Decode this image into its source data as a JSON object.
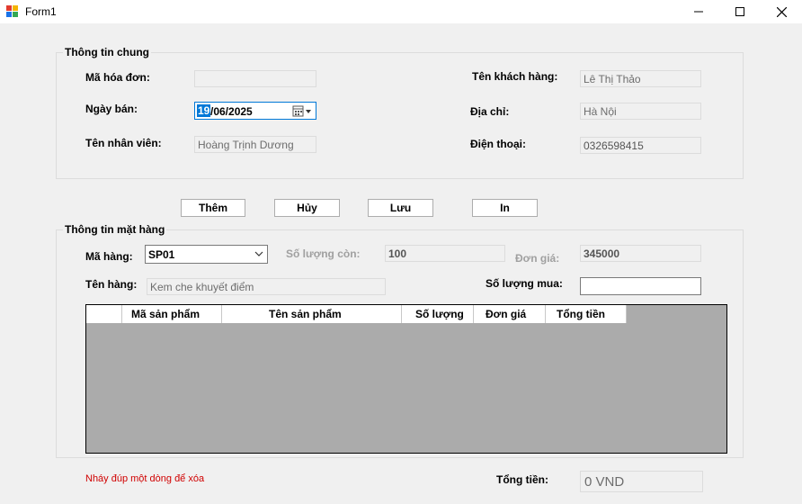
{
  "window": {
    "title": "Form1",
    "icons": {
      "app": "app-form-icon",
      "minimize": "minimize-icon",
      "maximize": "maximize-icon",
      "close": "close-icon"
    }
  },
  "general_info": {
    "title": "Thông tin chung",
    "invoice_id_label": "Mã hóa đơn:",
    "invoice_id_value": "",
    "sale_date_label": "Ngày bán:",
    "sale_date": {
      "day": "19",
      "rest": "/06/2025"
    },
    "employee_label": "Tên nhân viên:",
    "employee_value": "Hoàng Trịnh Dương",
    "customer_label": "Tên khách hàng:",
    "customer_value": "Lê Thị Thảo",
    "address_label": "Địa chỉ:",
    "address_value": "Hà Nội",
    "phone_label": "Điện thoại:",
    "phone_value": "0326598415"
  },
  "buttons": {
    "add": "Thêm",
    "cancel": "Hủy",
    "save": "Lưu",
    "print": "In"
  },
  "item_info": {
    "title": "Thông tin mặt hàng",
    "item_code_label": "Mã hàng:",
    "item_code_value": "SP01",
    "stock_label": "Số lượng còn:",
    "stock_value": "100",
    "unit_price_label": "Đơn giá:",
    "unit_price_value": "345000",
    "item_name_label": "Tên hàng:",
    "item_name_value": "Kem che khuyết điểm",
    "buy_qty_label": "Số lượng mua:",
    "buy_qty_value": ""
  },
  "grid": {
    "columns": [
      "Mã sản phẩm",
      "Tên sản phẩm",
      "Số lượng",
      "Đơn giá",
      "Tổng tiền"
    ],
    "rows": []
  },
  "footer": {
    "hint": "Nháy đúp một dòng để xóa",
    "total_label": "Tổng tiền:",
    "total_value": "0 VND"
  },
  "colors": {
    "accent": "#0078d7",
    "hint": "#d00000",
    "grid_bg": "#ababab"
  }
}
